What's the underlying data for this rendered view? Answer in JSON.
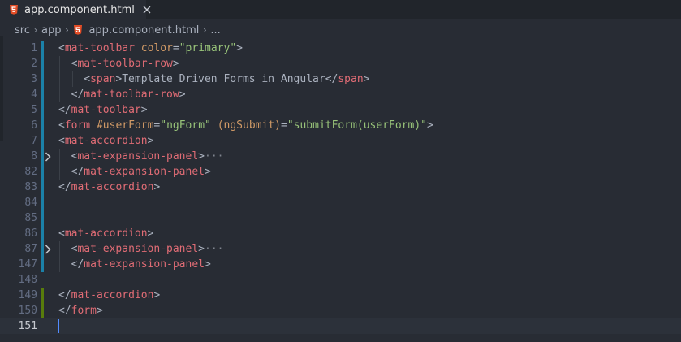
{
  "tab": {
    "label": "app.component.html",
    "close_glyph": "✕",
    "icon": "html5-icon"
  },
  "breadcrumb": {
    "items": [
      "src",
      "app",
      "app.component.html",
      "..."
    ],
    "separator": "›"
  },
  "colors": {
    "tag": "#e06c75",
    "attribute": "#d19a66",
    "string": "#98c379",
    "text": "#abb2bf",
    "change_blue": "#1b81a8",
    "change_green": "#587c0c",
    "html_icon": "#e44d26",
    "cursor": "#528bff"
  },
  "lines": [
    {
      "num": "1",
      "indent": 0,
      "change": "blue",
      "fold": false,
      "tokens": [
        {
          "t": "punct",
          "v": "<"
        },
        {
          "t": "tag",
          "v": "mat-toolbar"
        },
        {
          "t": "text",
          "v": " "
        },
        {
          "t": "attr",
          "v": "color"
        },
        {
          "t": "punct",
          "v": "="
        },
        {
          "t": "str",
          "v": "\"primary\""
        },
        {
          "t": "punct",
          "v": ">"
        }
      ]
    },
    {
      "num": "2",
      "indent": 1,
      "change": "blue",
      "fold": false,
      "tokens": [
        {
          "t": "punct",
          "v": "<"
        },
        {
          "t": "tag",
          "v": "mat-toolbar-row"
        },
        {
          "t": "punct",
          "v": ">"
        }
      ]
    },
    {
      "num": "3",
      "indent": 2,
      "change": "blue",
      "fold": false,
      "tokens": [
        {
          "t": "punct",
          "v": "<"
        },
        {
          "t": "tag",
          "v": "span"
        },
        {
          "t": "punct",
          "v": ">"
        },
        {
          "t": "text",
          "v": "Template Driven Forms in Angular"
        },
        {
          "t": "punct",
          "v": "</"
        },
        {
          "t": "tag",
          "v": "span"
        },
        {
          "t": "punct",
          "v": ">"
        }
      ]
    },
    {
      "num": "4",
      "indent": 1,
      "change": "blue",
      "fold": false,
      "tokens": [
        {
          "t": "punct",
          "v": "</"
        },
        {
          "t": "tag",
          "v": "mat-toolbar-row"
        },
        {
          "t": "punct",
          "v": ">"
        }
      ]
    },
    {
      "num": "5",
      "indent": 0,
      "change": "blue",
      "fold": false,
      "tokens": [
        {
          "t": "punct",
          "v": "</"
        },
        {
          "t": "tag",
          "v": "mat-toolbar"
        },
        {
          "t": "punct",
          "v": ">"
        }
      ]
    },
    {
      "num": "6",
      "indent": 0,
      "change": "blue",
      "fold": false,
      "tokens": [
        {
          "t": "punct",
          "v": "<"
        },
        {
          "t": "tag",
          "v": "form"
        },
        {
          "t": "text",
          "v": " "
        },
        {
          "t": "attr",
          "v": "#userForm"
        },
        {
          "t": "punct",
          "v": "="
        },
        {
          "t": "str",
          "v": "\"ngForm\""
        },
        {
          "t": "text",
          "v": " "
        },
        {
          "t": "attr",
          "v": "(ngSubmit)"
        },
        {
          "t": "punct",
          "v": "="
        },
        {
          "t": "str",
          "v": "\"submitForm(userForm)\""
        },
        {
          "t": "punct",
          "v": ">"
        }
      ]
    },
    {
      "num": "7",
      "indent": 0,
      "change": "blue",
      "fold": false,
      "tokens": [
        {
          "t": "punct",
          "v": "<"
        },
        {
          "t": "tag",
          "v": "mat-accordion"
        },
        {
          "t": "punct",
          "v": ">"
        }
      ]
    },
    {
      "num": "8",
      "indent": 1,
      "change": "blue",
      "fold": true,
      "tokens": [
        {
          "t": "punct",
          "v": "<"
        },
        {
          "t": "tag",
          "v": "mat-expansion-panel"
        },
        {
          "t": "punct",
          "v": ">"
        },
        {
          "t": "fold",
          "v": "···"
        }
      ]
    },
    {
      "num": "82",
      "indent": 1,
      "change": "blue",
      "fold": false,
      "tokens": [
        {
          "t": "punct",
          "v": "</"
        },
        {
          "t": "tag",
          "v": "mat-expansion-panel"
        },
        {
          "t": "punct",
          "v": ">"
        }
      ]
    },
    {
      "num": "83",
      "indent": 0,
      "change": "blue",
      "fold": false,
      "tokens": [
        {
          "t": "punct",
          "v": "</"
        },
        {
          "t": "tag",
          "v": "mat-accordion"
        },
        {
          "t": "punct",
          "v": ">"
        }
      ]
    },
    {
      "num": "84",
      "indent": 0,
      "change": "blue",
      "fold": false,
      "tokens": []
    },
    {
      "num": "85",
      "indent": 0,
      "change": "blue",
      "fold": false,
      "tokens": []
    },
    {
      "num": "86",
      "indent": 0,
      "change": "blue",
      "fold": false,
      "tokens": [
        {
          "t": "punct",
          "v": "<"
        },
        {
          "t": "tag",
          "v": "mat-accordion"
        },
        {
          "t": "punct",
          "v": ">"
        }
      ]
    },
    {
      "num": "87",
      "indent": 1,
      "change": "blue",
      "fold": true,
      "tokens": [
        {
          "t": "punct",
          "v": "<"
        },
        {
          "t": "tag",
          "v": "mat-expansion-panel"
        },
        {
          "t": "punct",
          "v": ">"
        },
        {
          "t": "fold",
          "v": "···"
        }
      ]
    },
    {
      "num": "147",
      "indent": 1,
      "change": "blue",
      "fold": false,
      "tokens": [
        {
          "t": "punct",
          "v": "</"
        },
        {
          "t": "tag",
          "v": "mat-expansion-panel"
        },
        {
          "t": "punct",
          "v": ">"
        }
      ]
    },
    {
      "num": "148",
      "indent": 0,
      "change": "none",
      "fold": false,
      "tokens": []
    },
    {
      "num": "149",
      "indent": 0,
      "change": "green",
      "fold": false,
      "tokens": [
        {
          "t": "punct",
          "v": "</"
        },
        {
          "t": "tag",
          "v": "mat-accordion"
        },
        {
          "t": "punct",
          "v": ">"
        }
      ]
    },
    {
      "num": "150",
      "indent": 0,
      "change": "green",
      "fold": false,
      "tokens": [
        {
          "t": "punct",
          "v": "</"
        },
        {
          "t": "tag",
          "v": "form"
        },
        {
          "t": "punct",
          "v": ">"
        }
      ]
    },
    {
      "num": "151",
      "indent": 0,
      "change": "none",
      "fold": false,
      "active": true,
      "tokens": []
    }
  ]
}
